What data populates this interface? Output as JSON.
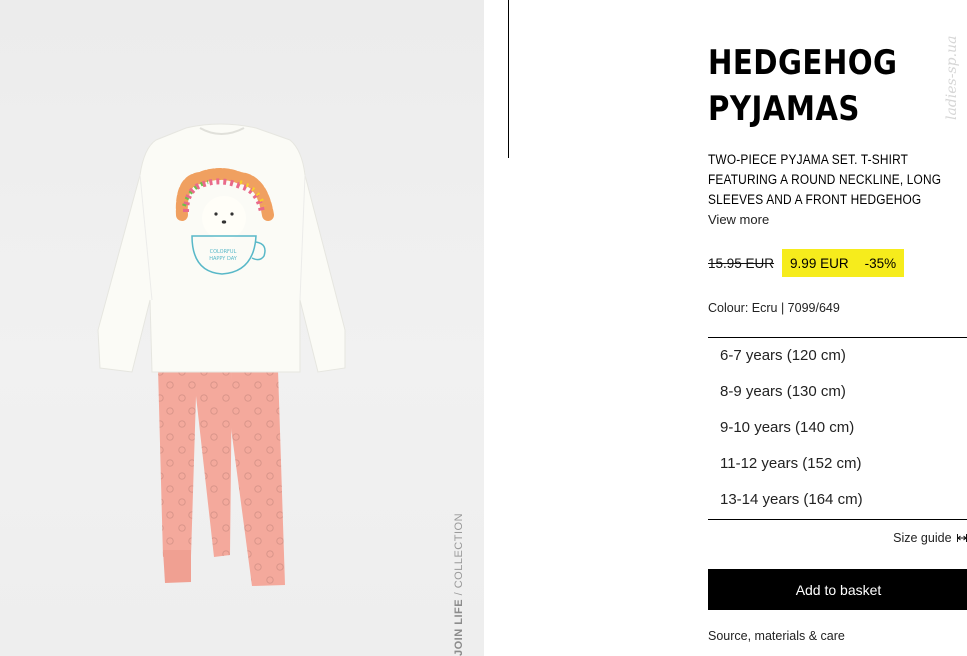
{
  "product": {
    "title": "HEDGEHOG PYJAMAS",
    "description": "TWO-PIECE PYJAMA SET. T-SHIRT FEATURING A ROUND NECKLINE, LONG SLEEVES AND A FRONT HEDGEHOG",
    "view_more": "View more",
    "old_price": "15.95 EUR",
    "price": "9.99 EUR",
    "discount": "-35%",
    "colour": "Colour: Ecru | 7099/649",
    "sizes": [
      {
        "label": "6-7 years (120 cm)"
      },
      {
        "label": "8-9 years (130 cm)"
      },
      {
        "label": "9-10 years (140 cm)"
      },
      {
        "label": "11-12 years (152 cm)"
      },
      {
        "label": "13-14 years (164 cm)"
      }
    ],
    "size_guide": "Size guide",
    "add_to_basket": "Add to basket",
    "materials": "Source, materials & care"
  },
  "image": {
    "side_label_bold": "JOIN LIFE",
    "side_label_rest": " / COLLECTION",
    "shirt_text": [
      "COLORFUL",
      "HAPPY DAY"
    ]
  },
  "watermark": "ladies-sp.ua",
  "colors": {
    "sale_highlight": "#f6ec1c",
    "button_bg": "#000000",
    "pants": "#f4a79a",
    "shirt": "#fbfbf6"
  },
  "icons": {
    "size_guide": "ruler-arrows-icon"
  }
}
